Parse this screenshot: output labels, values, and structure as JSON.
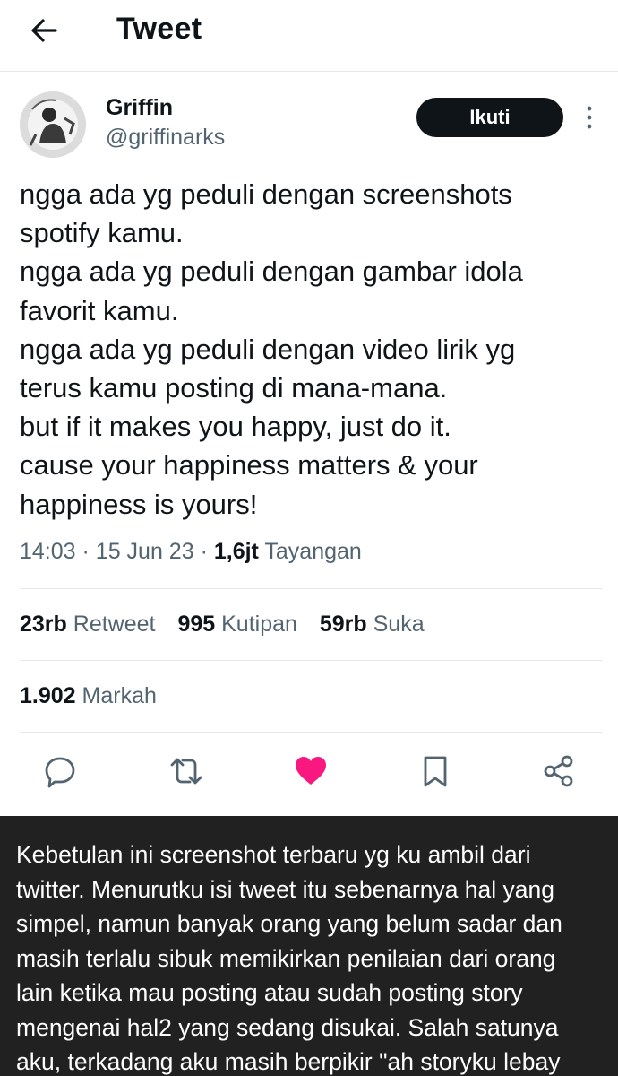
{
  "header": {
    "back_icon": "arrow-left-icon",
    "title": "Tweet"
  },
  "author": {
    "name": "Griffin",
    "handle": "@griffinarks",
    "follow_label": "Ikuti",
    "more_icon": "more-vertical-icon"
  },
  "tweet": {
    "lines": [
      "ngga ada yg peduli dengan screenshots",
      "spotify kamu.",
      "ngga ada yg peduli dengan gambar idola",
      "favorit kamu.",
      "ngga ada yg peduli dengan video lirik yg",
      "terus kamu posting di mana-mana.",
      "but if it makes you happy,  just do it.",
      "cause your happiness matters & your",
      "happiness is yours!"
    ],
    "time": "14:03",
    "date": "15 Jun 23",
    "views_count": "1,6jt",
    "views_label": "Tayangan"
  },
  "stats": {
    "retweets_count": "23rb",
    "retweets_label": "Retweet",
    "quotes_count": "995",
    "quotes_label": "Kutipan",
    "likes_count": "59rb",
    "likes_label": "Suka",
    "bookmarks_count": "1.902",
    "bookmarks_label": "Markah"
  },
  "actions": {
    "reply_icon": "reply-icon",
    "retweet_icon": "retweet-icon",
    "like_icon": "heart-icon",
    "like_color": "#f91880",
    "bookmark_icon": "bookmark-icon",
    "share_icon": "share-icon"
  },
  "caption": {
    "lines": [
      "Kebetulan ini screenshot terbaru yg ku ambil dari",
      "twitter. Menurutku isi tweet itu sebenarnya hal yang",
      "simpel, namun banyak orang yang belum sadar dan",
      "masih terlalu sibuk memikirkan penilaian dari orang",
      "lain ketika mau posting atau sudah posting story",
      "mengenai hal2 yang sedang disukai. Salah satunya",
      "aku, terkadang aku masih berpikir \"ah storyku lebay"
    ]
  }
}
